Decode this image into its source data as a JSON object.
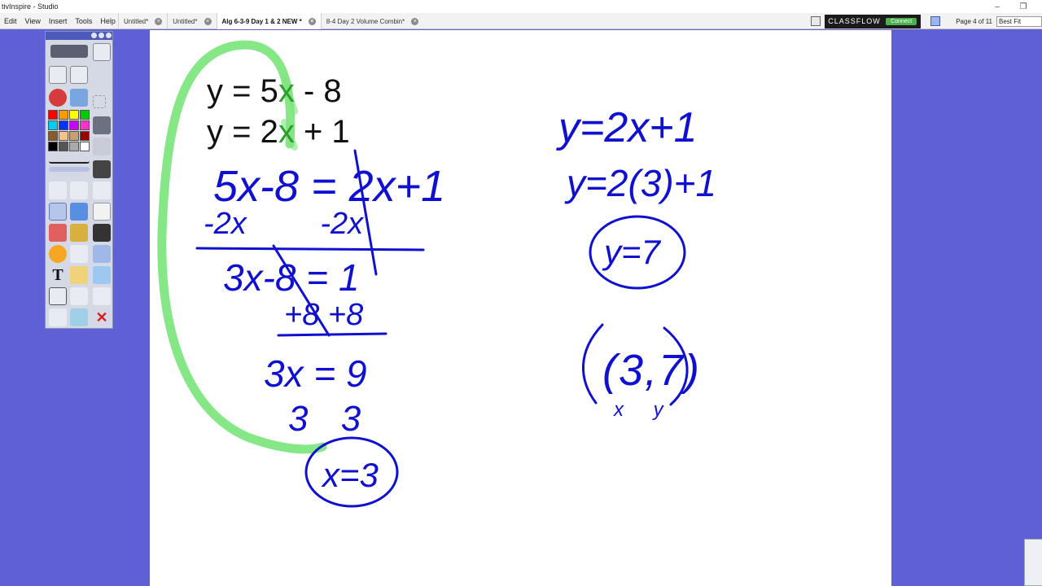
{
  "window": {
    "title": "tivInspire - Studio",
    "minimize": "–",
    "restore": "❐"
  },
  "menu": [
    "Edit",
    "View",
    "Insert",
    "Tools",
    "Help"
  ],
  "tabs": [
    {
      "label": "Untitled*",
      "active": false
    },
    {
      "label": "Untitled*",
      "active": false
    },
    {
      "label": "Alg 6-3-9 Day 1 & 2 NEW *",
      "active": true
    },
    {
      "label": "8-4 Day 2 Volume Combin*",
      "active": false
    }
  ],
  "classflow": {
    "brand": "CLASSFLOW",
    "connect_label": "Connect"
  },
  "page_indicator": "Page 4 of 11",
  "zoom": "Best Fit",
  "flipchart": {
    "typed_equations": [
      {
        "before": "y = 5",
        "var": "x",
        "after": " - 8"
      },
      {
        "before": "y = 2",
        "var": "x",
        "after": " + 1"
      }
    ],
    "handwritten": [
      "5x-8 = 2x+1",
      "-2x -2x",
      "3x-8 = 1",
      "+8 +8",
      "3x = 9",
      "3 3",
      "x=3",
      "y=2x+1",
      "y=2(3)+1",
      "y=7",
      "(3,7)",
      "x y"
    ]
  },
  "colors": {
    "ink_blue": "#1010d0",
    "highlighter_green": "#7ee67e",
    "background": "#6060d6"
  }
}
